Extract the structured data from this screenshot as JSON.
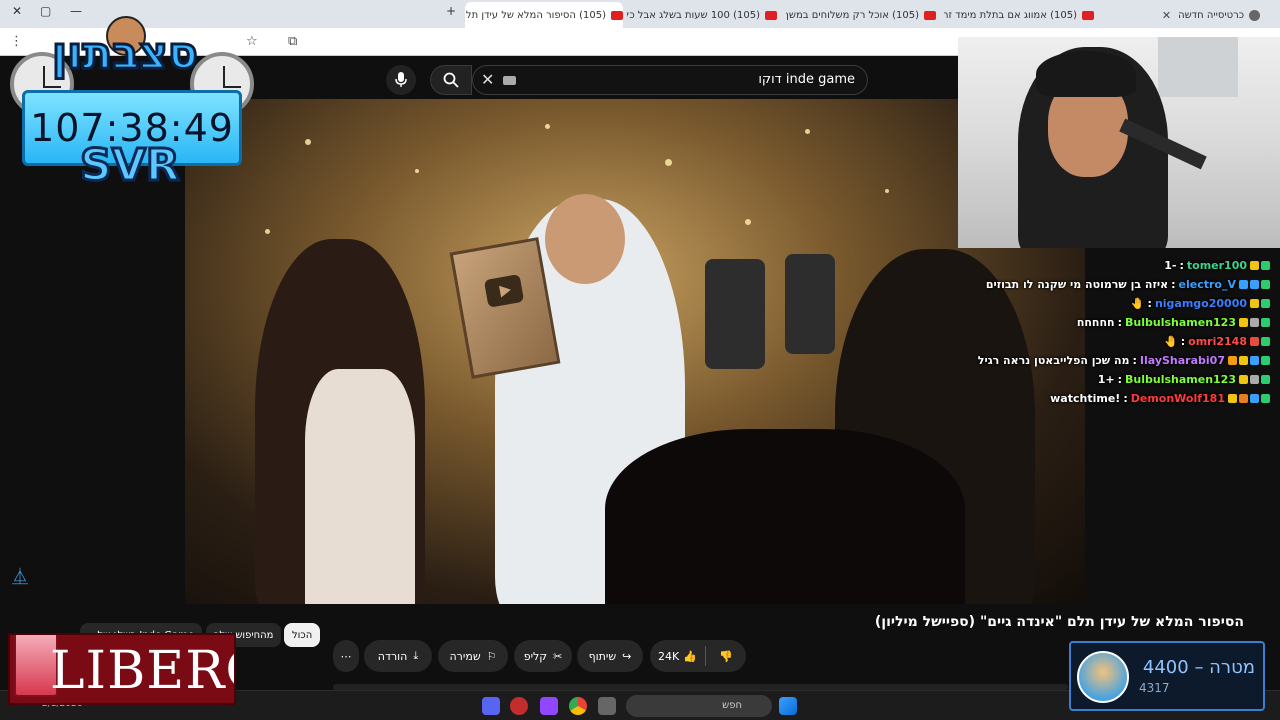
{
  "browser": {
    "tabs": [
      {
        "title": "כרטיסייה חדשה",
        "icon": "chrome-icon"
      },
      {
        "title": "(105) אמווג אם בתלת מימד זה...",
        "icon": "youtube-icon"
      },
      {
        "title": "(105) אוכל רק משלוחים במשך...",
        "icon": "youtube-icon"
      },
      {
        "title": "(105) 100 שעות בשלג אבל כל...",
        "icon": "youtube-icon"
      },
      {
        "title": "(105) הסיפור המלא של עידן תלם...",
        "icon": "youtube-icon",
        "active": true
      }
    ],
    "new_tab_label": "+",
    "window_controls": [
      "—",
      "▢",
      "✕"
    ]
  },
  "youtube": {
    "search_query": "inde game דוקו",
    "video_title": "הסיפור המלא של עידן תלם \"אינדה גיים\" (ספיישל מיליון)",
    "actions": {
      "likes": "24K",
      "share": "שיתוף",
      "clip": "קליפ",
      "save": "שמירה",
      "download": "הורדה",
      "more": "⋯"
    },
    "chips": [
      {
        "label": "הכול",
        "selected": true
      },
      {
        "label": "מהחיפוש שלך",
        "selected": false
      },
      {
        "label": "Inde Game בשלג של...",
        "selected": false
      }
    ]
  },
  "overlay": {
    "banner": "סצבתון",
    "timer": "107:38:49",
    "server": "SVR",
    "chat": [
      {
        "user": "tomer100",
        "user_color": "#3ad28f",
        "msg": "-1"
      },
      {
        "user": "electro_V",
        "user_color": "#3aa0ff",
        "msg": "איזה בן שרמוטה מי שקנה לו תבוזים"
      },
      {
        "user": "nigamgo20000",
        "user_color": "#3a7fff",
        "msg": "🤚"
      },
      {
        "user": "Bulbulshamen123",
        "user_color": "#7dff3a",
        "msg": "חחחחח"
      },
      {
        "user": "omri2148",
        "user_color": "#ff4a4a",
        "msg": "🤚"
      },
      {
        "user": "IlaySharabi07",
        "user_color": "#c27aff",
        "msg": "מה שכן הפלייבאטן נראה רגיל"
      },
      {
        "user": "Bulbulshamen123",
        "user_color": "#7dff3a",
        "msg": "+1"
      },
      {
        "user": "DemonWolf181",
        "user_color": "#ff3a3a",
        "msg": "!watchtime"
      }
    ],
    "goal": {
      "label": "מטרה",
      "separator": "–",
      "target": "4400",
      "current": "4317"
    },
    "sponsor": "LIBERO"
  },
  "taskbar": {
    "search_placeholder": "חפש",
    "date": "2/1/2026"
  },
  "colors": {
    "accent": "#29b6f6",
    "youtube_red": "#e02020",
    "sponsor": "#7a0b14"
  }
}
